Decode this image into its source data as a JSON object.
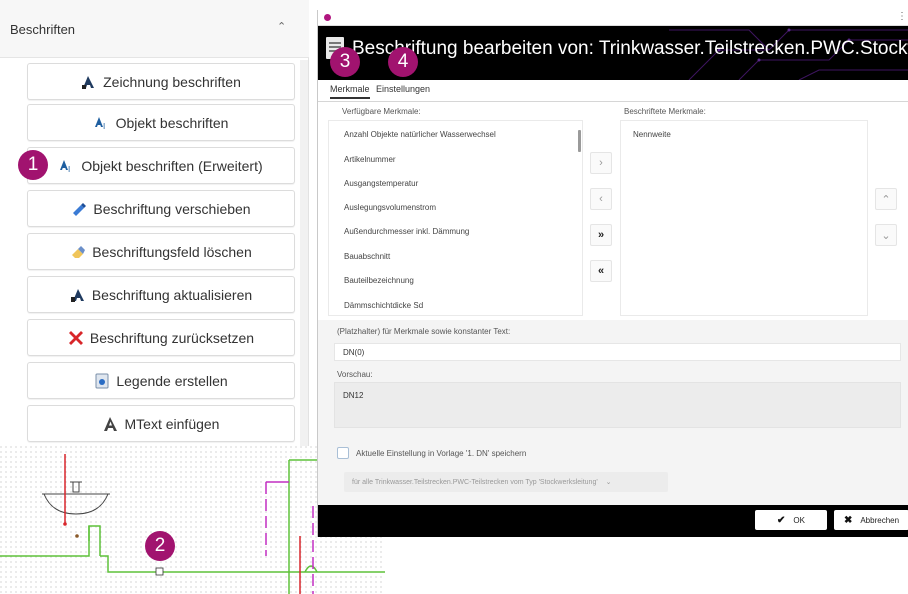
{
  "left_panel": {
    "title": "Beschriften",
    "buttons": [
      {
        "label": "Zeichnung beschriften",
        "icon": "label-drawing-icon"
      },
      {
        "label": "Objekt beschriften",
        "icon": "label-object-icon"
      },
      {
        "label": "Objekt beschriften (Erweitert)",
        "icon": "label-object-advanced-icon"
      },
      {
        "label": "Beschriftung verschieben",
        "icon": "move-label-icon"
      },
      {
        "label": "Beschriftungsfeld löschen",
        "icon": "eraser-icon"
      },
      {
        "label": "Beschriftung aktualisieren",
        "icon": "refresh-label-icon"
      },
      {
        "label": "Beschriftung zurücksetzen",
        "icon": "reset-x-icon"
      },
      {
        "label": "Legende erstellen",
        "icon": "legend-icon"
      },
      {
        "label": "MText einfügen",
        "icon": "mtext-icon"
      }
    ]
  },
  "dialog": {
    "title": "Beschriftung bearbeiten von: Trinkwasser.Teilstrecken.PWC.Stockwerksleitung",
    "tabs": [
      "Merkmale",
      "Einstellungen"
    ],
    "available_label": "Verfügbare Merkmale:",
    "available_items": [
      "Anzahl Objekte natürlicher Wasserwechsel",
      "Artikelnummer",
      "Ausgangstemperatur",
      "Auslegungsvolumenstrom",
      "Außendurchmesser inkl. Dämmung",
      "Bauabschnitt",
      "Bauteilbezeichnung",
      "Dämmschichtdicke Sd"
    ],
    "assigned_label": "Beschriftete Merkmale:",
    "assigned_items": [
      "Nennweite"
    ],
    "placeholder_label": "(Platzhalter) für Merkmale sowie konstanter Text:",
    "placeholder_value": "DN(0)",
    "preview_label": "Vorschau:",
    "preview_value": "DN12",
    "save_checkbox_label": "Aktuelle Einstellung in Vorlage '1. DN' speichern",
    "scope_value": "für alle Trinkwasser.Teilstrecken.PWC-Teilstrecken vom Typ 'Stockwerksleitung'",
    "ok_label": "OK",
    "cancel_label": "Abbrechen"
  },
  "callouts": [
    "1",
    "2",
    "3",
    "4"
  ],
  "colors": {
    "callout": "#a1136f",
    "pipe_green": "#5fc23a",
    "pipe_magenta": "#c22fc2",
    "pipe_red": "#d9262c",
    "app_accent": "#b0167f"
  }
}
